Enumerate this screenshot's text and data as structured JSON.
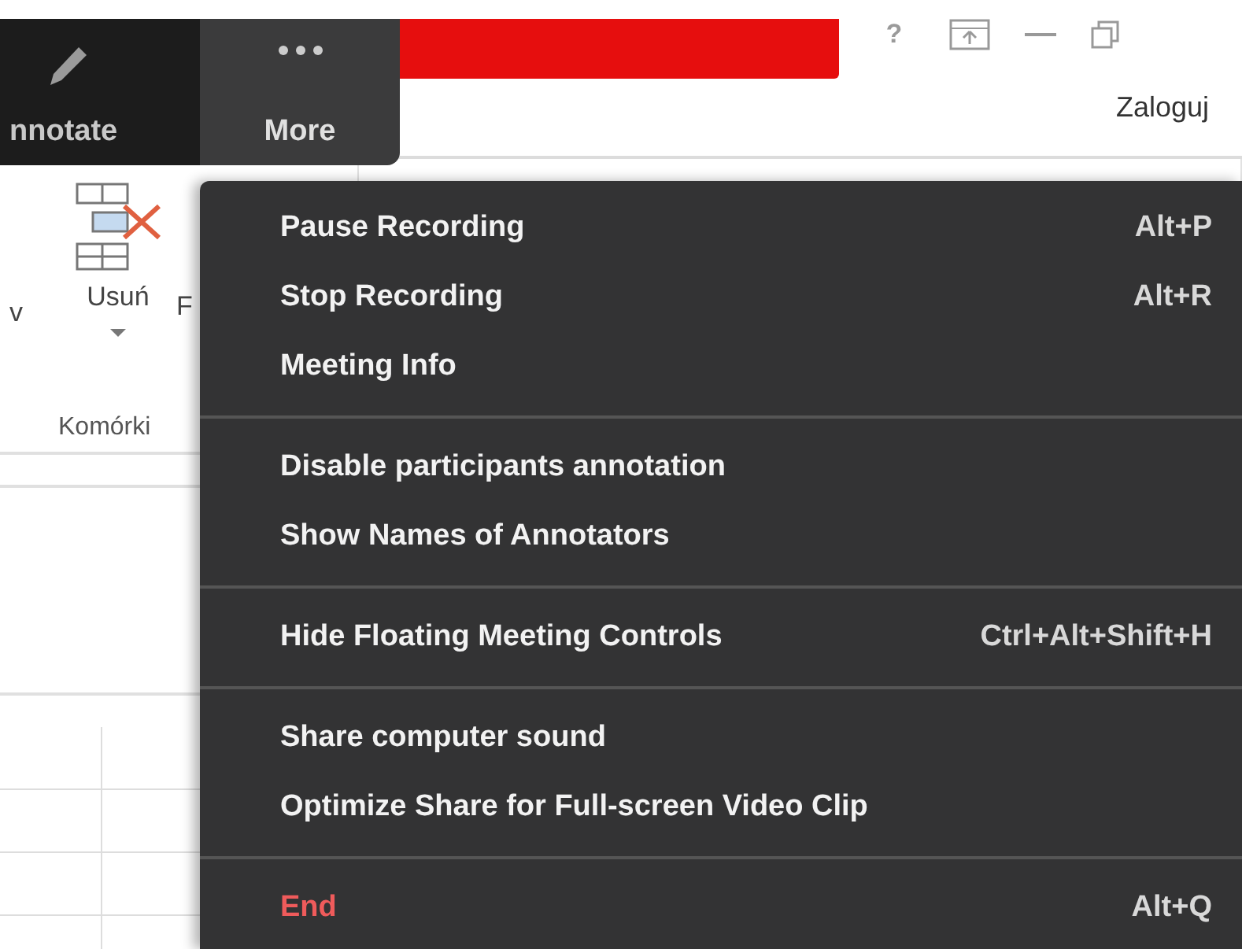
{
  "toolbar": {
    "buttons": [
      {
        "label": "nnotate",
        "kind": "pencil",
        "selected": false
      },
      {
        "label": "More",
        "kind": "more",
        "selected": true
      }
    ]
  },
  "title_bar": {
    "help": "?",
    "account": "Zaloguj"
  },
  "ribbon": {
    "fragment": "v",
    "groups": [
      {
        "title": "Komórki",
        "buttons": [
          {
            "lines": [
              "Usuń"
            ],
            "kind": "delete"
          },
          {
            "lines": [
              "F"
            ],
            "kind": "format"
          }
        ]
      }
    ]
  },
  "menu": {
    "groups": [
      [
        {
          "label": "Pause Recording",
          "shortcut": "Alt+P",
          "kind": "normal"
        },
        {
          "label": "Stop Recording",
          "shortcut": "Alt+R",
          "kind": "normal"
        },
        {
          "label": "Meeting Info",
          "kind": "normal"
        }
      ],
      [
        {
          "label": "Disable participants annotation",
          "kind": "normal"
        },
        {
          "label": "Show Names of Annotators",
          "kind": "normal"
        }
      ],
      [
        {
          "label": "Hide Floating Meeting Controls",
          "shortcut": "Ctrl+Alt+Shift+H",
          "kind": "normal"
        }
      ],
      [
        {
          "label": "Share computer sound",
          "kind": "normal"
        },
        {
          "label": "Optimize Share for Full-screen Video Clip",
          "kind": "normal"
        }
      ],
      [
        {
          "label": "End",
          "shortcut": "Alt+Q",
          "kind": "danger"
        }
      ]
    ]
  }
}
